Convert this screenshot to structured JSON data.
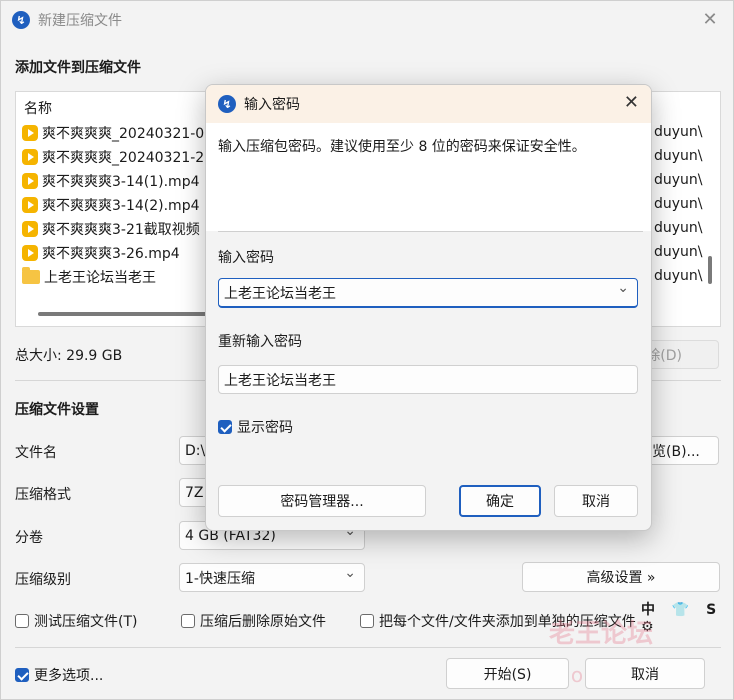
{
  "main": {
    "title": "新建压缩文件",
    "section_add": "添加文件到压缩文件",
    "list": {
      "header": "名称",
      "rows": [
        {
          "name": "爽不爽爽爽_20240321-0",
          "path": "duyun\\",
          "type": "video"
        },
        {
          "name": "爽不爽爽爽_20240321-2",
          "path": "duyun\\",
          "type": "video"
        },
        {
          "name": "爽不爽爽爽3-14(1).mp4",
          "path": "duyun\\",
          "type": "video"
        },
        {
          "name": "爽不爽爽爽3-14(2).mp4",
          "path": "duyun\\",
          "type": "video"
        },
        {
          "name": "爽不爽爽爽3-21截取视频",
          "path": "duyun\\",
          "type": "video"
        },
        {
          "name": "爽不爽爽爽3-26.mp4",
          "path": "duyun\\",
          "type": "video"
        },
        {
          "name": "上老王论坛当老王",
          "path": "duyun\\",
          "type": "folder"
        }
      ]
    },
    "total_size": "总大小: 29.9 GB",
    "remove_btn": "除(D)",
    "section_settings": "压缩文件设置",
    "filename_label": "文件名",
    "filename_value": "D:\\",
    "browse_btn": "览(B)...",
    "format_label": "压缩格式",
    "format_value": "7Z",
    "split_label": "分卷",
    "split_value": "4 GB (FAT32)",
    "level_label": "压缩级别",
    "level_value": "1-快速压缩",
    "advanced_btn": "高级设置 »",
    "chk_test": "测试压缩文件(T)",
    "chk_delete": "压缩后删除原始文件",
    "chk_each": "把每个文件/文件夹添加到单独的压缩文件",
    "chk_more": "更多选项...",
    "start_btn": "开始(S)",
    "cancel_btn": "取消",
    "watermark": "老王论坛",
    "watermark_url": "laowang",
    "corner_icons": "中 👕 S ⚙"
  },
  "dialog": {
    "title": "输入密码",
    "description": "输入压缩包密码。建议使用至少 8 位的密码来保证安全性。",
    "password_label": "输入密码",
    "password_value": "上老王论坛当老王",
    "reenter_label": "重新输入密码",
    "reenter_value": "上老王论坛当老王",
    "show_password": "显示密码",
    "manager_btn": "密码管理器...",
    "ok_btn": "确定",
    "cancel_btn": "取消"
  },
  "colors": {
    "accent": "#1f5fbf",
    "dialog_title_bg": "#fbf1e6",
    "file_icon": "#f5b400",
    "folder_icon": "#f6c443"
  }
}
